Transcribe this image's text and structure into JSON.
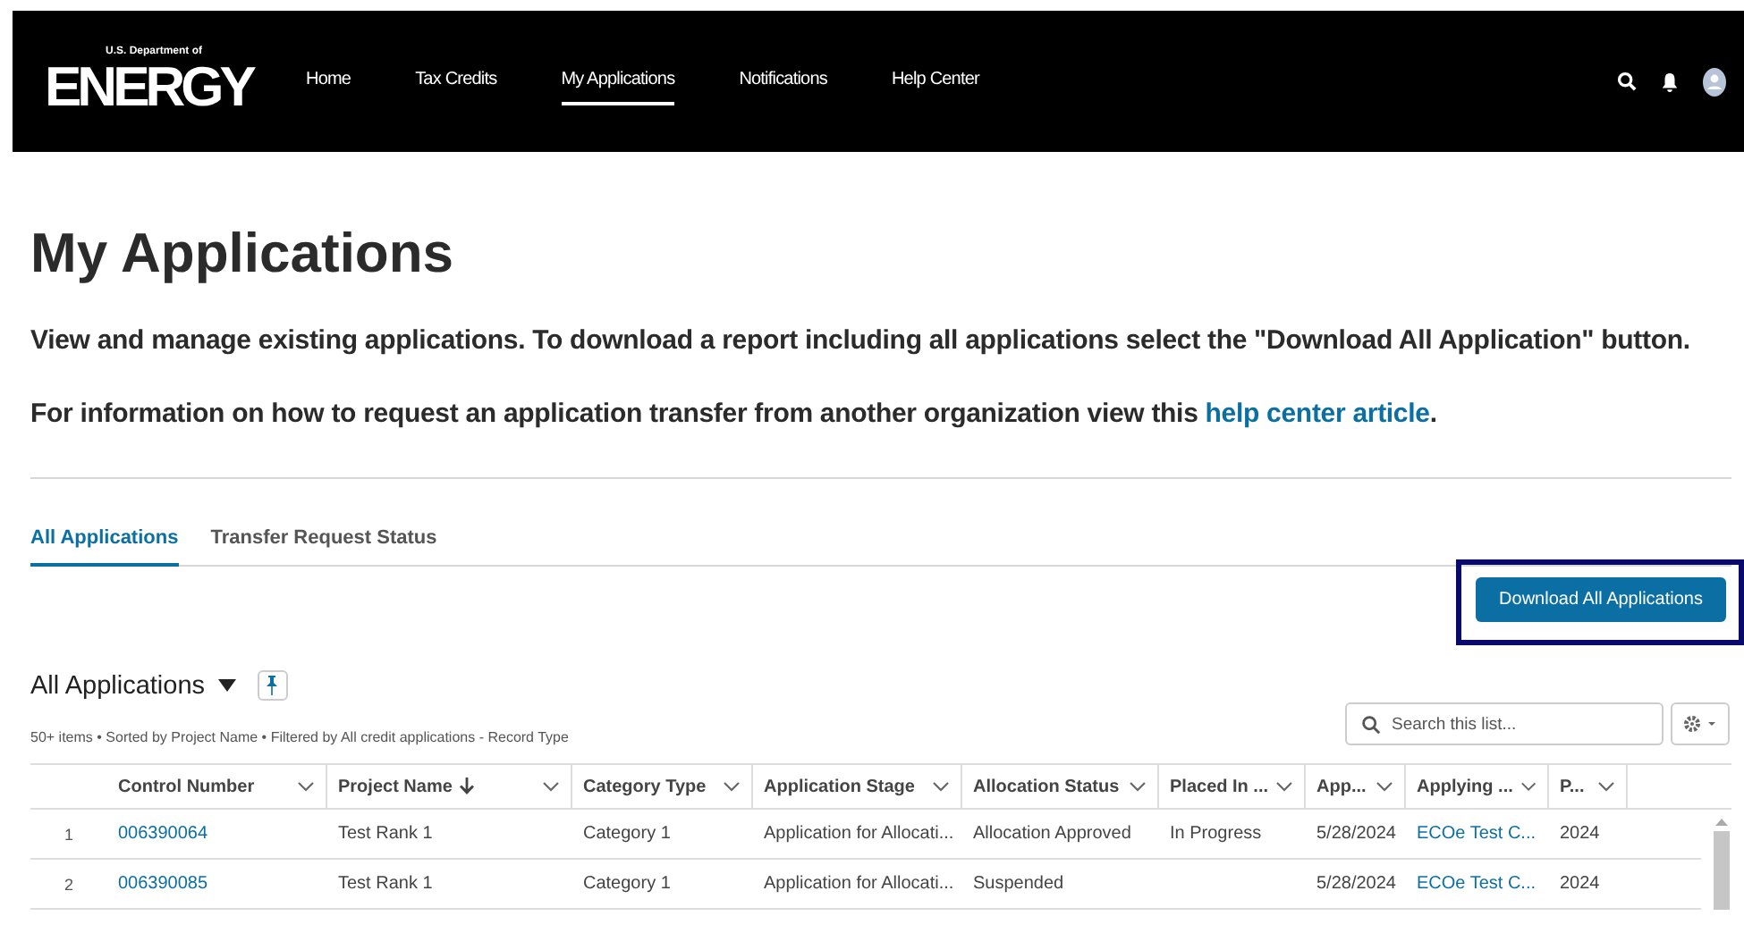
{
  "header": {
    "logo": {
      "super": "U.S. Department of",
      "word": "ENERGY"
    },
    "nav": [
      {
        "label": "Home",
        "selected": false
      },
      {
        "label": "Tax Credits",
        "selected": false
      },
      {
        "label": "My Applications",
        "selected": true
      },
      {
        "label": "Notifications",
        "selected": false
      },
      {
        "label": "Help Center",
        "selected": false
      }
    ]
  },
  "page": {
    "title": "My Applications",
    "intro": "View and manage existing applications. To download a report including all applications select the \"Download All Application\" button.",
    "transfer_note": {
      "text": "For information on how to request an application transfer from another organization view this",
      "link": "help center article",
      "after": "."
    }
  },
  "tabs": [
    {
      "label": "All Applications",
      "selected": true
    },
    {
      "label": "Transfer Request Status",
      "selected": false
    }
  ],
  "download_button": {
    "label": "Download All Applications",
    "highlighted": true
  },
  "list": {
    "title": "All Applications",
    "meta": "50+ items • Sorted by Project Name • Filtered by All credit applications - Record Type",
    "search": {
      "placeholder": "Search this list..."
    },
    "columns": [
      {
        "label": "Control Number",
        "sorted": false,
        "link": true
      },
      {
        "label": "Project Name",
        "sorted": true,
        "link": false
      },
      {
        "label": "Category Type",
        "sorted": false,
        "link": false
      },
      {
        "label": "Application Stage",
        "sorted": false,
        "link": false
      },
      {
        "label": "Allocation Status",
        "sorted": false,
        "link": false
      },
      {
        "label": "Placed In ...",
        "sorted": false,
        "link": false
      },
      {
        "label": "App...",
        "sorted": false,
        "link": false
      },
      {
        "label": "Applying ...",
        "sorted": false,
        "link": true
      },
      {
        "label": "P...",
        "sorted": false,
        "link": false
      }
    ],
    "rows": [
      {
        "number": "1",
        "cells": [
          "006390064",
          "Test Rank 1",
          "Category 1",
          "Application for Allocati...",
          "Allocation Approved",
          "In Progress",
          "5/28/2024",
          "ECOe Test C...",
          "2024"
        ]
      },
      {
        "number": "2",
        "cells": [
          "006390085",
          "Test Rank 1",
          "Category 1",
          "Application for Allocati...",
          "Suspended",
          "",
          "5/28/2024",
          "ECOe Test C...",
          "2024"
        ]
      }
    ]
  }
}
